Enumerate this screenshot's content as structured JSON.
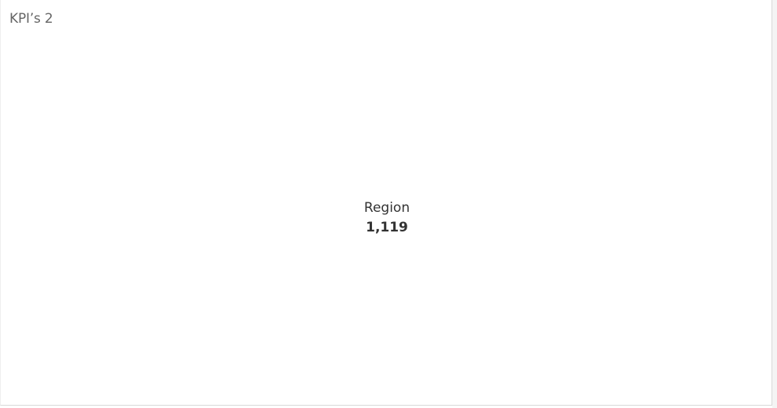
{
  "sheet": {
    "title": "KPI’s 2"
  },
  "kpi": {
    "label": "Region",
    "value": "1,119"
  },
  "colors": {
    "background": "#ffffff",
    "title_text": "#666666",
    "kpi_text": "#333333",
    "border": "#d9d9d9"
  }
}
